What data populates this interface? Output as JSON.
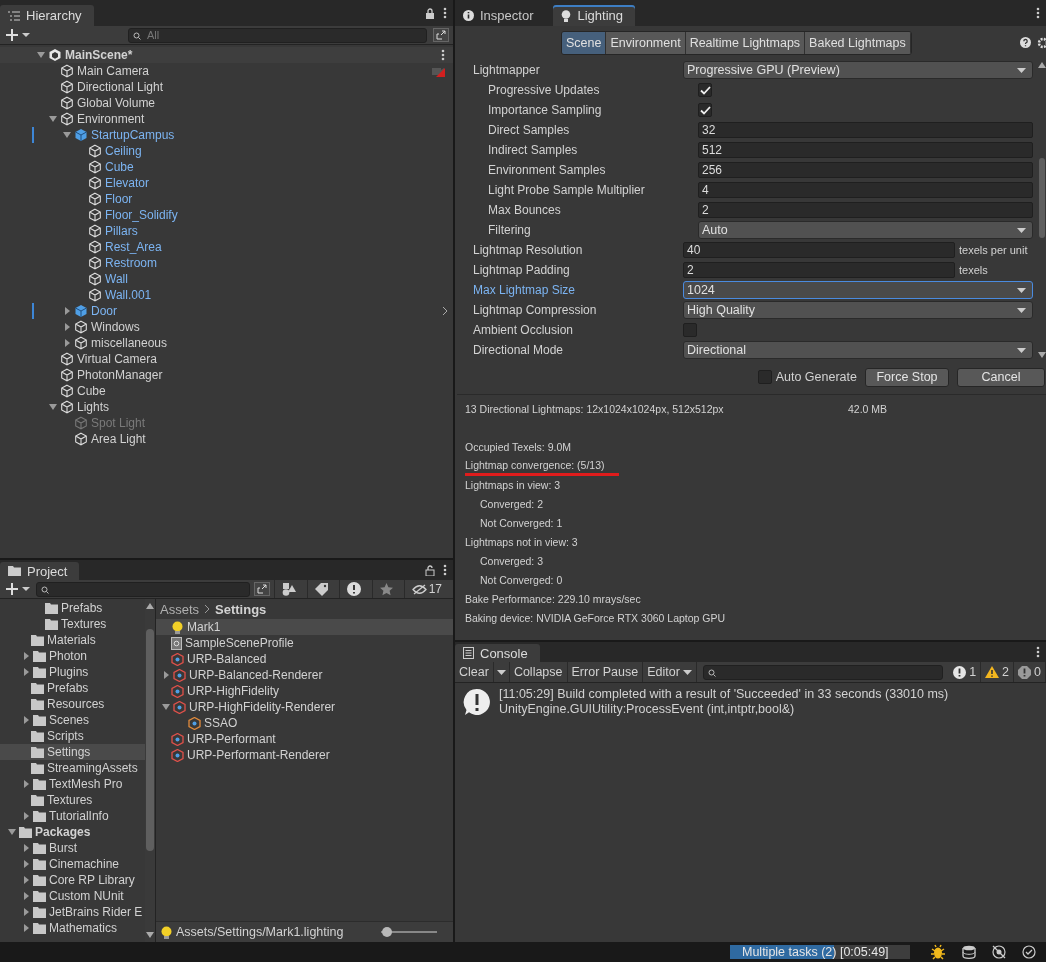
{
  "hierarchy": {
    "tab": "Hierarchy",
    "search": {
      "placeholder": "All"
    },
    "scene": {
      "label": "MainScene*",
      "expanded": true
    },
    "items": [
      {
        "label": "Main Camera",
        "kind": "object",
        "marker": true
      },
      {
        "label": "Directional Light",
        "kind": "object"
      },
      {
        "label": "Global Volume",
        "kind": "object"
      },
      {
        "label": "Environment",
        "kind": "object",
        "expanded": true,
        "children": [
          {
            "label": "StartupCampus",
            "kind": "prefab_root",
            "modified": true,
            "expanded": true,
            "children": [
              {
                "label": "Ceiling",
                "kind": "prefab_part"
              },
              {
                "label": "Cube",
                "kind": "prefab_part"
              },
              {
                "label": "Elevator",
                "kind": "prefab_part"
              },
              {
                "label": "Floor",
                "kind": "prefab_part"
              },
              {
                "label": "Floor_Solidify",
                "kind": "prefab_part"
              },
              {
                "label": "Pillars",
                "kind": "prefab_part"
              },
              {
                "label": "Rest_Area",
                "kind": "prefab_part"
              },
              {
                "label": "Restroom",
                "kind": "prefab_part"
              },
              {
                "label": "Wall",
                "kind": "prefab_part"
              },
              {
                "label": "Wall.001",
                "kind": "prefab_part"
              }
            ]
          },
          {
            "label": "Door",
            "kind": "prefab_root",
            "modified": true,
            "expanded": false,
            "open_arrow": true
          },
          {
            "label": "Windows",
            "kind": "object",
            "expanded": false
          },
          {
            "label": "miscellaneous",
            "kind": "object",
            "expanded": false
          }
        ]
      },
      {
        "label": "Virtual Camera",
        "kind": "object"
      },
      {
        "label": "PhotonManager",
        "kind": "object"
      },
      {
        "label": "Cube",
        "kind": "object"
      },
      {
        "label": "Lights",
        "kind": "object",
        "expanded": true,
        "children": [
          {
            "label": "Spot Light",
            "kind": "object",
            "disabled": true
          },
          {
            "label": "Area Light",
            "kind": "object"
          }
        ]
      }
    ]
  },
  "project": {
    "tab": "Project",
    "hidden_count": "17",
    "folder_tree": [
      {
        "children": [
          {
            "children": [
              {
                "label": "Prefabs",
                "selected": false
              },
              {
                "label": "Textures",
                "selected": false
              }
            ]
          },
          {
            "label": "Materials",
            "selected": false
          },
          {
            "label": "Photon",
            "expanded": false,
            "selected": false
          },
          {
            "label": "Plugins",
            "expanded": false,
            "selected": false
          },
          {
            "label": "Prefabs",
            "selected": false
          },
          {
            "label": "Resources",
            "selected": false
          },
          {
            "label": "Scenes",
            "expanded": false,
            "selected": false
          },
          {
            "label": "Scripts",
            "selected": false
          },
          {
            "label": "Settings",
            "selected": true
          },
          {
            "label": "StreamingAssets",
            "selected": false
          },
          {
            "label": "TextMesh Pro",
            "expanded": false,
            "selected": false
          },
          {
            "label": "Textures",
            "selected": false
          },
          {
            "label": "TutorialInfo",
            "expanded": false,
            "selected": false
          }
        ]
      },
      {
        "label": "Packages",
        "expanded": true,
        "selected": false,
        "children": [
          {
            "label": "Burst",
            "expanded": false,
            "selected": false
          },
          {
            "label": "Cinemachine",
            "expanded": false,
            "selected": false
          },
          {
            "label": "Core RP Library",
            "expanded": false,
            "selected": false
          },
          {
            "label": "Custom NUnit",
            "expanded": false,
            "selected": false
          },
          {
            "label": "JetBrains Rider E",
            "expanded": false,
            "selected": false
          },
          {
            "label": "Mathematics",
            "expanded": false,
            "selected": false
          }
        ]
      }
    ],
    "breadcrumb": [
      "Assets",
      "Settings"
    ],
    "assets": [
      {
        "label": "Mark1",
        "kind": "lighting",
        "selected": true
      },
      {
        "label": "SampleSceneProfile",
        "kind": "profile",
        "selected": false
      },
      {
        "label": "URP-Balanced",
        "kind": "pipeline",
        "selected": false
      },
      {
        "label": "URP-Balanced-Renderer",
        "kind": "pipeline",
        "expanded": false,
        "selected": false
      },
      {
        "label": "URP-HighFidelity",
        "kind": "pipeline",
        "selected": false
      },
      {
        "label": "URP-HighFidelity-Renderer",
        "kind": "pipeline",
        "expanded": true,
        "selected": false,
        "children": [
          {
            "label": "SSAO",
            "kind": "feature",
            "selected": false
          }
        ]
      },
      {
        "label": "URP-Performant",
        "kind": "pipeline",
        "selected": false
      },
      {
        "label": "URP-Performant-Renderer",
        "kind": "pipeline",
        "selected": false
      }
    ],
    "footer": {
      "path": "Assets/Settings/Mark1.lighting",
      "kind": "lighting"
    },
    "icon_size": {
      "level": 0.1
    }
  },
  "inspector": {
    "tabs": [
      {
        "label": "Inspector",
        "kind": "info",
        "selected": false
      },
      {
        "label": "Lighting",
        "kind": "bulb",
        "selected": true
      }
    ],
    "subtabs": [
      {
        "label": "Scene",
        "selected": true
      },
      {
        "label": "Environment",
        "selected": false
      },
      {
        "label": "Realtime Lightmaps",
        "selected": false
      },
      {
        "label": "Baked Lightmaps",
        "selected": false
      }
    ],
    "properties": [
      {
        "label": "Lightmapper",
        "kind": "dropdown",
        "value": "Progressive GPU (Preview)",
        "children": [
          {
            "label": "Progressive Updates",
            "kind": "checkbox",
            "checked": true
          },
          {
            "label": "Importance Sampling",
            "kind": "checkbox",
            "checked": true
          },
          {
            "label": "Direct Samples",
            "kind": "number",
            "value": "32"
          },
          {
            "label": "Indirect Samples",
            "kind": "number",
            "value": "512"
          },
          {
            "label": "Environment Samples",
            "kind": "number",
            "value": "256"
          },
          {
            "label": "Light Probe Sample Multiplier",
            "kind": "number",
            "value": "4"
          },
          {
            "label": "Max Bounces",
            "kind": "number",
            "value": "2"
          },
          {
            "label": "Filtering",
            "kind": "dropdown",
            "value": "Auto"
          }
        ]
      },
      {
        "label": "Lightmap Resolution",
        "kind": "number",
        "value": "40",
        "unit": "texels per unit"
      },
      {
        "label": "Lightmap Padding",
        "kind": "number",
        "value": "2",
        "unit": "texels"
      },
      {
        "label": "Max Lightmap Size",
        "kind": "dropdown",
        "value": "1024",
        "highlighted": true
      },
      {
        "label": "Lightmap Compression",
        "kind": "dropdown",
        "value": "High Quality"
      },
      {
        "label": "Ambient Occlusion",
        "kind": "checkbox",
        "checked": false
      },
      {
        "label": "Directional Mode",
        "kind": "dropdown",
        "value": "Directional"
      }
    ],
    "auto_generate": {
      "label": "Auto Generate",
      "checked": false
    },
    "buttons": [
      "Force Stop",
      "Cancel"
    ],
    "stats": [
      {
        "text": "13 Directional Lightmaps: 12x1024x1024px, 512x512px",
        "value": "42.0 MB"
      },
      {
        "text": "Occupied Texels: 9.0M"
      },
      {
        "text": "Lightmap convergence: (5/13)",
        "underlined": true
      },
      {
        "text": "Lightmaps in view: 3",
        "children": [
          {
            "text": "Converged: 2"
          },
          {
            "text": "Not Converged: 1"
          }
        ]
      },
      {
        "text": "Lightmaps not in view: 3",
        "children": [
          {
            "text": "Converged: 3"
          },
          {
            "text": "Not Converged: 0"
          }
        ]
      },
      {
        "text": "Bake Performance: 229.10 mrays/sec"
      },
      {
        "text": "Baking device: NVIDIA GeForce RTX 3060 Laptop GPU"
      }
    ]
  },
  "console": {
    "tab": "Console",
    "toolbar": [
      "Clear",
      "Collapse",
      "Error Pause",
      "Editor"
    ],
    "counts": [
      {
        "kind": "log",
        "count": "1"
      },
      {
        "kind": "warning",
        "count": "2"
      },
      {
        "kind": "error",
        "count": "0"
      }
    ],
    "messages": [
      {
        "kind": "log",
        "lines": [
          "[11:05:29] Build completed with a result of 'Succeeded' in 33 seconds (33010 ms)",
          "UnityEngine.GUIUtility:ProcessEvent (int,intptr,bool&)"
        ]
      }
    ]
  },
  "status_bar": {
    "task": "Multiple tasks (2) [0:05:49]",
    "level": 0.58
  }
}
